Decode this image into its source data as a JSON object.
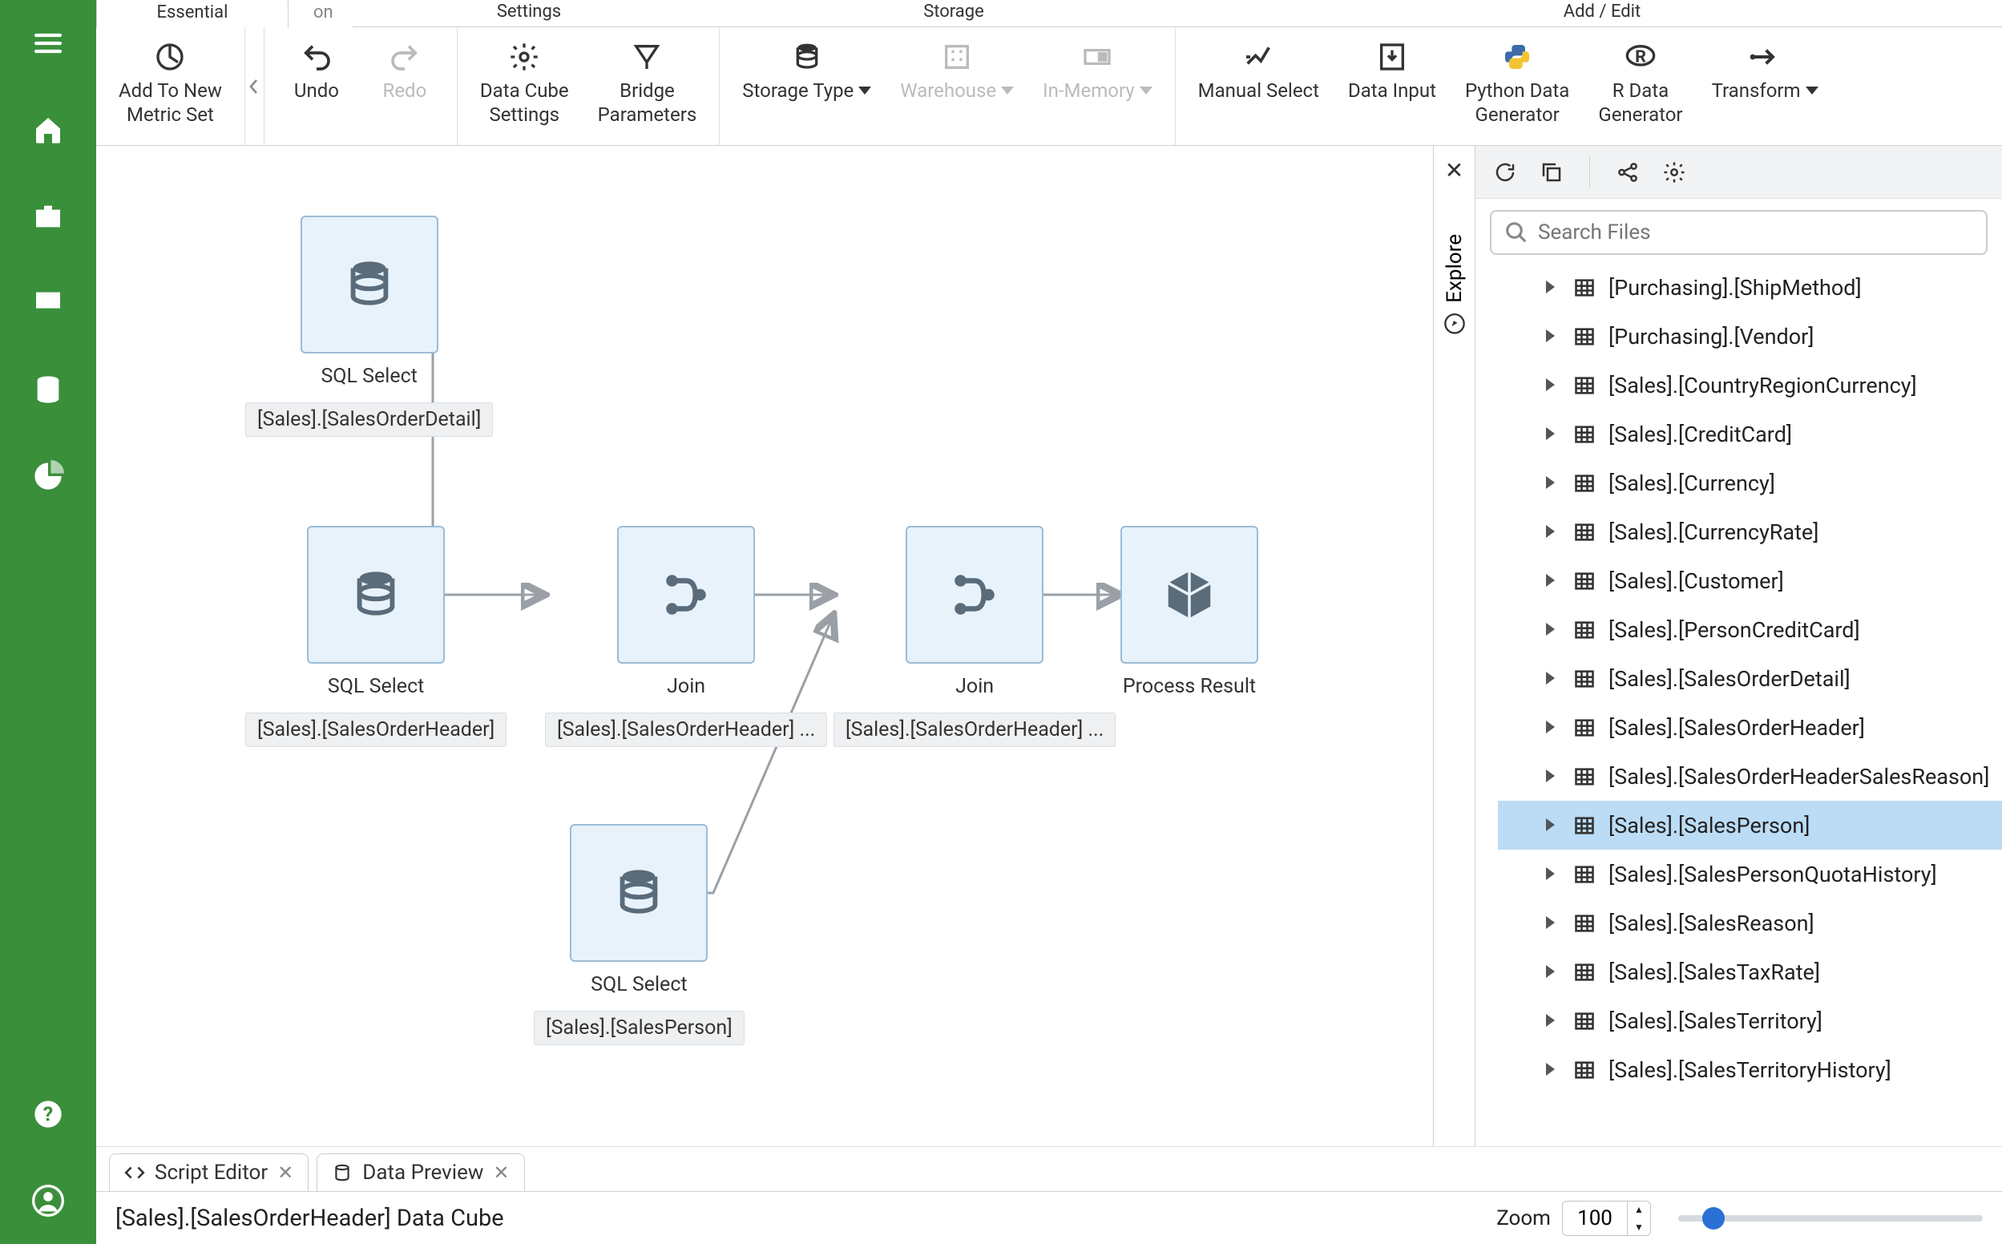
{
  "ribbon_tabs": {
    "essential": "Essential",
    "partial": "on",
    "settings": "Settings",
    "storage": "Storage",
    "add_edit": "Add / Edit"
  },
  "ribbon": {
    "add_metric_set": "Add To New\nMetric Set",
    "undo": "Undo",
    "redo": "Redo",
    "data_cube_settings": "Data Cube\nSettings",
    "bridge_parameters": "Bridge\nParameters",
    "storage_type": "Storage Type",
    "warehouse": "Warehouse",
    "in_memory": "In-Memory",
    "manual_select": "Manual Select",
    "data_input": "Data Input",
    "python_gen": "Python Data\nGenerator",
    "r_gen": "R Data\nGenerator",
    "transform": "Transform"
  },
  "nodes": {
    "n1": {
      "label": "SQL Select",
      "sub": "[Sales].[SalesOrderDetail]"
    },
    "n2": {
      "label": "SQL Select",
      "sub": "[Sales].[SalesOrderHeader]"
    },
    "n3": {
      "label": "Join",
      "sub": "[Sales].[SalesOrderHeader] ..."
    },
    "n4": {
      "label": "SQL Select",
      "sub": "[Sales].[SalesPerson]"
    },
    "n5": {
      "label": "Join",
      "sub": "[Sales].[SalesOrderHeader] ..."
    },
    "n6": {
      "label": "Process Result"
    }
  },
  "explore": {
    "title": "Explore",
    "search_placeholder": "Search Files",
    "items": [
      "[Purchasing].[ShipMethod]",
      "[Purchasing].[Vendor]",
      "[Sales].[CountryRegionCurrency]",
      "[Sales].[CreditCard]",
      "[Sales].[Currency]",
      "[Sales].[CurrencyRate]",
      "[Sales].[Customer]",
      "[Sales].[PersonCreditCard]",
      "[Sales].[SalesOrderDetail]",
      "[Sales].[SalesOrderHeader]",
      "[Sales].[SalesOrderHeaderSalesReason]",
      "[Sales].[SalesPerson]",
      "[Sales].[SalesPersonQuotaHistory]",
      "[Sales].[SalesReason]",
      "[Sales].[SalesTaxRate]",
      "[Sales].[SalesTerritory]",
      "[Sales].[SalesTerritoryHistory]"
    ],
    "selected_index": 11
  },
  "bottom": {
    "script_editor": "Script Editor",
    "data_preview": "Data Preview",
    "title": "[Sales].[SalesOrderHeader] Data Cube",
    "zoom_label": "Zoom",
    "zoom_value": "100"
  }
}
